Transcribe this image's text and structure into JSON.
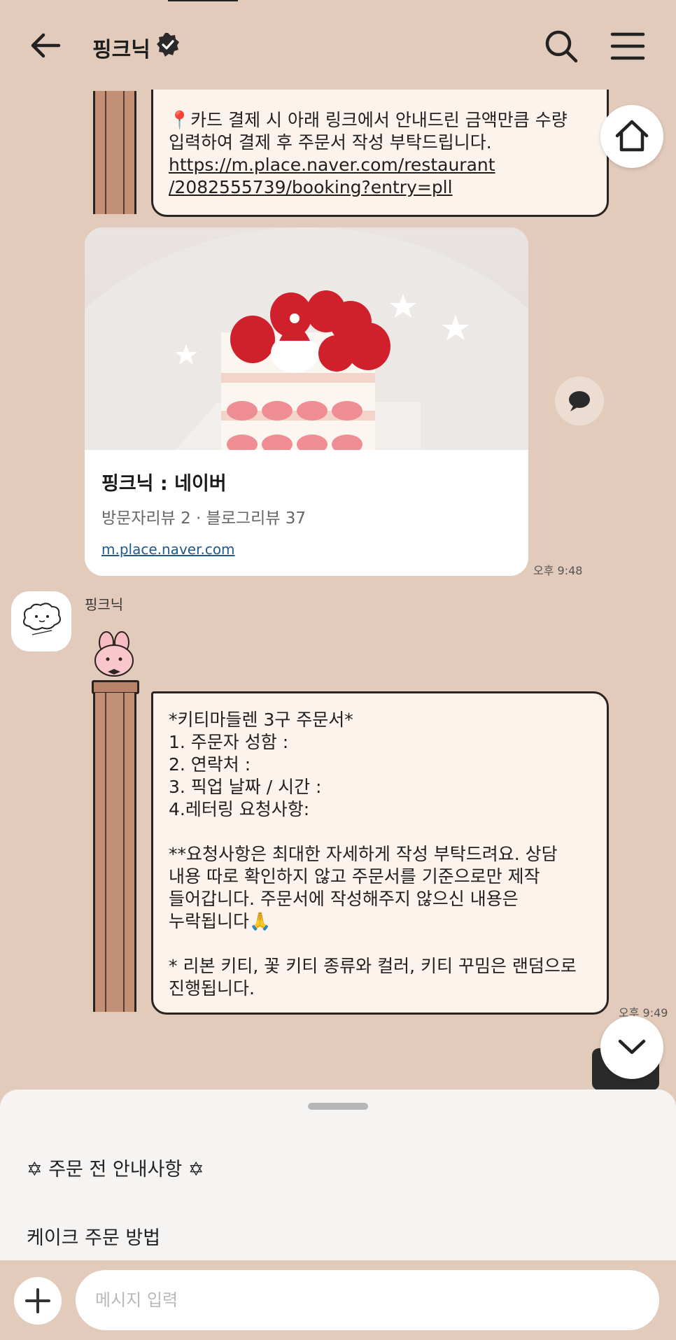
{
  "header": {
    "title": "핑크닉"
  },
  "messages": {
    "prev_bubble": {
      "lines": [
        "📍카드 결제 시 아래 링크에서 안내드린 금액만큼 수량",
        "입력하여 결제 후 주문서 작성 부탁드립니다.",
        "https://m.place.naver.com/restaurant",
        "/2082555739/booking?entry=pll"
      ]
    },
    "card": {
      "title": "핑크닉 : 네이버",
      "subtitle": "방문자리뷰 2 · 블로그리뷰 37",
      "link": "m.place.naver.com",
      "time": "오후 9:48"
    },
    "sender": {
      "name": "핑크닉"
    },
    "order_bubble": {
      "lines": [
        "*키티마들렌 3구 주문서*",
        "1. 주문자 성함 :",
        "2. 연락처 :",
        "3. 픽업 날짜 / 시간 :",
        "4.레터링 요청사항:",
        "",
        "**요청사항은 최대한 자세하게 작성 부탁드려요. 상담",
        "내용 따로 확인하지 않고 주문서를 기준으로만 제작",
        "들어갑니다. 주문서에 작성해주지 않으신 내용은",
        "누락됩니다🙏",
        "",
        "* 리본 키티, 꽃 키티 종류와 컬러, 키티 꾸밈은 랜덤으로",
        "진행됩니다."
      ],
      "time": "오후 9:49"
    }
  },
  "sheet": {
    "items": [
      "✡ 주문 전 안내사항 ✡",
      "케이크 주문 방법"
    ]
  },
  "input": {
    "placeholder": "메시지 입력"
  },
  "colors": {
    "background": "#e3cbbb",
    "bubble": "#fdf3ed",
    "border": "#2b2320",
    "link": "#1e5a8c"
  }
}
